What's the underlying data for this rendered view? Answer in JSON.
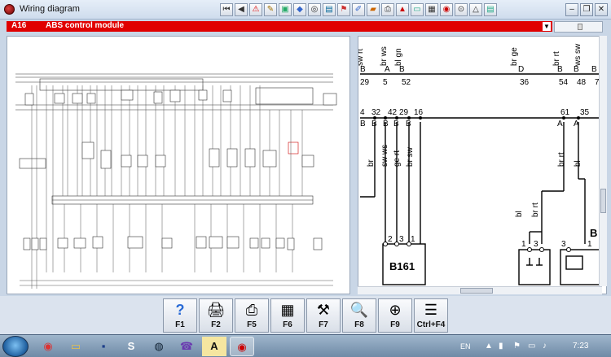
{
  "window": {
    "title": "Wiring diagram"
  },
  "toolbar_icons": [
    "first-page-icon",
    "previous-icon",
    "warning-icon",
    "notes-icon",
    "map-icon",
    "chart-icon",
    "disc-icon",
    "component-icon",
    "flag-icon",
    "edit-icon",
    "car-icon",
    "print-icon",
    "warning-car-icon",
    "document-icon",
    "grid-icon",
    "search-car-icon",
    "target-icon",
    "tools-icon",
    "filter-icon"
  ],
  "module": {
    "code": "A16",
    "name": "ABS control module"
  },
  "detail": {
    "top_wires": [
      "sw rt",
      "br ws",
      "bl gn",
      "br ge",
      "br rt",
      "ws sw"
    ],
    "top_pins": [
      "29",
      "5",
      "52",
      "36",
      "54",
      "48",
      "7"
    ],
    "top_letters": [
      "B",
      "A",
      "B",
      "D",
      "B",
      "B",
      "B"
    ],
    "mid_pins": [
      "4",
      "32",
      "42",
      "29",
      "16",
      "61",
      "35"
    ],
    "mid_letters": [
      "B",
      "B",
      "B",
      "B",
      "B",
      "A",
      "A"
    ],
    "mid_wires": [
      "br",
      "sw ws",
      "ge rt",
      "br sw",
      "br rt",
      "bl"
    ],
    "lower_wires": [
      "bl",
      "br rt"
    ],
    "connector_pins": [
      "2",
      "3",
      "1",
      "1",
      "3",
      "3",
      "1"
    ],
    "components": [
      "B161",
      "B"
    ]
  },
  "function_keys": [
    {
      "key": "F1",
      "icon": "help-icon",
      "glyph": "?"
    },
    {
      "key": "F2",
      "icon": "print-setup-icon",
      "glyph": "🖨"
    },
    {
      "key": "F5",
      "icon": "printer-icon",
      "glyph": "⎙"
    },
    {
      "key": "F6",
      "icon": "fuse-icon",
      "glyph": "▦"
    },
    {
      "key": "F7",
      "icon": "wrench-icon",
      "glyph": "⚒"
    },
    {
      "key": "F8",
      "icon": "zoom-component-icon",
      "glyph": "🔍"
    },
    {
      "key": "F9",
      "icon": "magnify-target-icon",
      "glyph": "⊕"
    },
    {
      "key": "Ctrl+F4",
      "icon": "list-icon",
      "glyph": "☰"
    }
  ],
  "taskbar": {
    "apps": [
      {
        "icon": "chrome-icon",
        "glyph": "◉"
      },
      {
        "icon": "folder-icon",
        "glyph": "▭"
      },
      {
        "icon": "save-icon",
        "glyph": "▪"
      },
      {
        "icon": "skype-icon",
        "glyph": "S"
      },
      {
        "icon": "bmw-icon",
        "glyph": "◍"
      },
      {
        "icon": "viber-icon",
        "glyph": "☎"
      },
      {
        "icon": "note-icon",
        "glyph": "A"
      },
      {
        "icon": "wiring-app-icon",
        "glyph": "◉"
      }
    ],
    "language": "EN",
    "clock": "7:23"
  }
}
